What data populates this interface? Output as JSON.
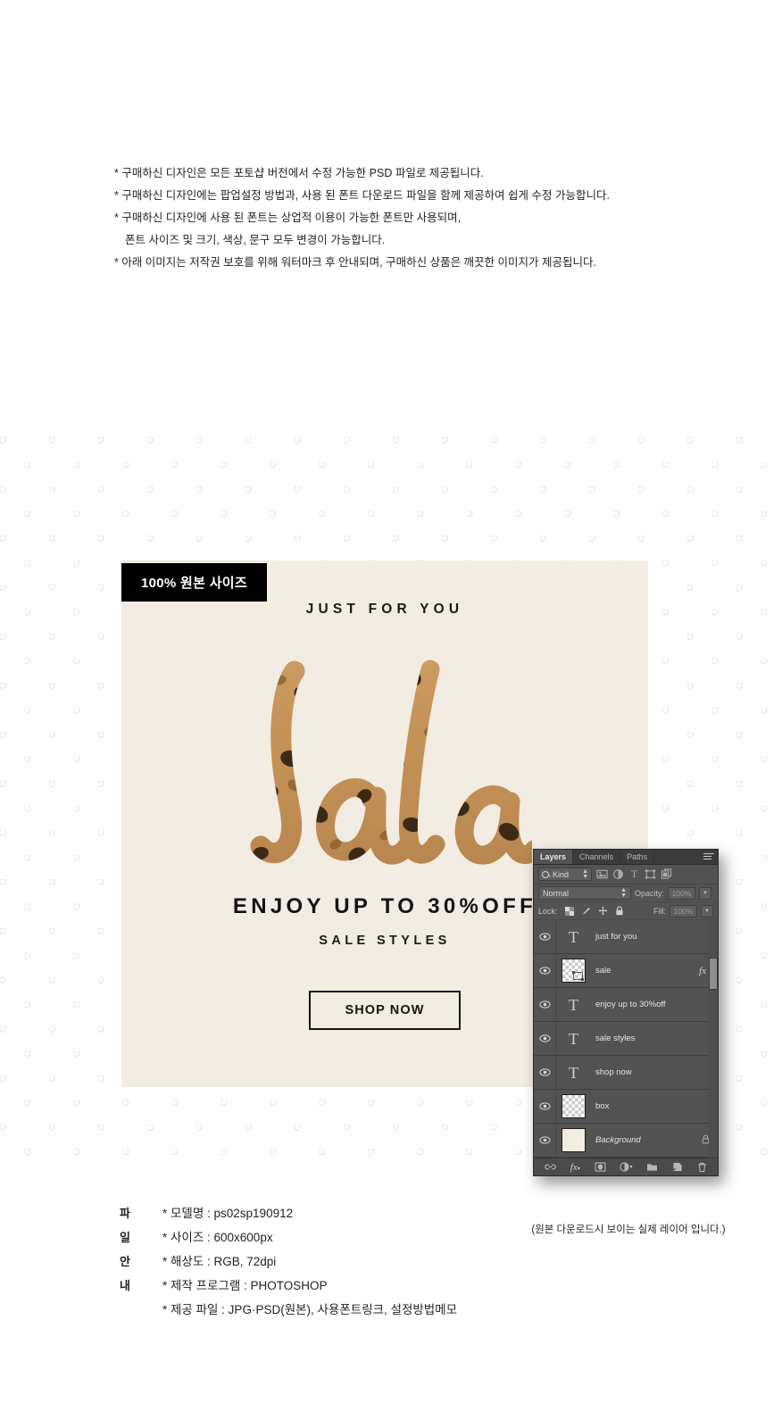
{
  "notice": {
    "lines": [
      "* 구매하신 디자인은 모든 포토샵 버전에서 수정 가능한 PSD 파일로 제공됩니다.",
      "* 구매하신 디자인에는 팝업설정 방법과, 사용 된 폰트 다운로드 파일을 함께 제공하여 쉽게 수정 가능합니다.",
      "* 구매하신 디자인에 사용 된 폰트는 상업적 이용이 가능한 폰트만 사용되며,",
      "폰트 사이즈 및 크기, 색상, 문구 모두 변경이 가능합니다.",
      "* 아래 이미지는 저작권 보호를 위해 워터마크 후 안내되며, 구매하신 상품은 깨끗한 이미지가 제공됩니다."
    ]
  },
  "size_badge": {
    "label": "100% 원본 사이즈"
  },
  "canvas": {
    "background_color": "#f2ece2",
    "headline_top": "JUST FOR YOU",
    "script_word": "Sale",
    "headline_main": "ENJOY UP TO 30%OFF",
    "subhead": "SALE STYLES",
    "cta_label": "SHOP NOW"
  },
  "photoshop_panel": {
    "tabs": [
      {
        "label": "Layers",
        "active": true
      },
      {
        "label": "Channels",
        "active": false
      },
      {
        "label": "Paths",
        "active": false
      }
    ],
    "menu_icon": "panel-menu-icon",
    "filter": {
      "kind_label": "Kind",
      "search_icon": "search-icon",
      "filter_icons": [
        "pixel-layer-icon",
        "adjustment-layer-icon",
        "type-layer-icon",
        "shape-layer-icon",
        "smart-object-icon"
      ]
    },
    "blend_mode": "Normal",
    "opacity_label": "Opacity:",
    "opacity_value": "100%",
    "lock_label": "Lock:",
    "lock_icons": [
      "transparency-lock-icon",
      "brush-lock-icon",
      "position-lock-icon",
      "all-lock-icon"
    ],
    "fill_label": "Fill:",
    "fill_value": "100%",
    "layers": [
      {
        "name": "just for you",
        "type": "text",
        "visible": true,
        "fx": false,
        "locked": false
      },
      {
        "name": "sale",
        "type": "smart",
        "visible": true,
        "fx": true,
        "locked": false
      },
      {
        "name": "enjoy up to 30%off",
        "type": "text",
        "visible": true,
        "fx": false,
        "locked": false
      },
      {
        "name": "sale styles",
        "type": "text",
        "visible": true,
        "fx": false,
        "locked": false
      },
      {
        "name": "shop now",
        "type": "text",
        "visible": true,
        "fx": false,
        "locked": false
      },
      {
        "name": "box",
        "type": "pixel",
        "visible": true,
        "fx": false,
        "locked": false
      },
      {
        "name": "Background",
        "type": "background",
        "visible": true,
        "fx": false,
        "locked": true
      }
    ],
    "bottom_icons": [
      "link-layers-icon",
      "layer-style-fx-icon",
      "layer-mask-icon",
      "adjustment-layer-icon",
      "new-group-icon",
      "new-layer-icon",
      "delete-layer-icon"
    ]
  },
  "panel_caption": "(원본 다운로드시 보이는 실제 레이어 입니다.)",
  "file_info": {
    "side_label_chars": [
      "파",
      "일",
      "안",
      "내"
    ],
    "rows": [
      "* 모델명 : ps02sp190912",
      "* 사이즈 : 600x600px",
      "* 해상도 : RGB, 72dpi",
      "* 제작 프로그램 : PHOTOSHOP",
      "* 제공 파일 : JPG·PSD(원본), 사용폰트링크, 설정방법메모"
    ]
  }
}
